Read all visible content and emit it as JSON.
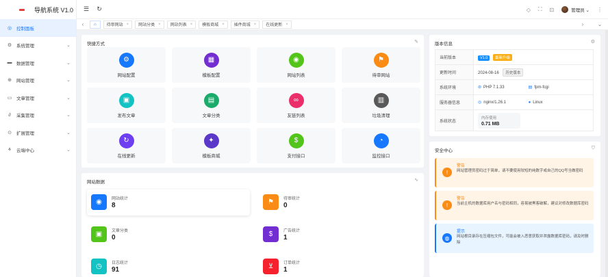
{
  "app": {
    "title": "导航系统 V1.0"
  },
  "sidebar": {
    "items": [
      {
        "label": "控制面板",
        "icon": "dashboard-icon",
        "glyph": "◎",
        "active": true
      },
      {
        "label": "系统管理",
        "icon": "gear-icon",
        "glyph": "⚙"
      },
      {
        "label": "数据管理",
        "icon": "database-icon",
        "glyph": "▬"
      },
      {
        "label": "网站管理",
        "icon": "globe-icon",
        "glyph": "⊕"
      },
      {
        "label": "文章管理",
        "icon": "book-icon",
        "glyph": "▭"
      },
      {
        "label": "采集管理",
        "icon": "link-icon",
        "glyph": "∂"
      },
      {
        "label": "扩展管理",
        "icon": "extension-icon",
        "glyph": "⊙"
      },
      {
        "label": "云端中心",
        "icon": "cloud-icon",
        "glyph": "⚘"
      }
    ]
  },
  "header": {
    "user": "管理员"
  },
  "tabs": [
    {
      "label": "待审网站"
    },
    {
      "label": "网站分类"
    },
    {
      "label": "网站列表"
    },
    {
      "label": "模板商城"
    },
    {
      "label": "插件商城"
    },
    {
      "label": "在线更新"
    }
  ],
  "quick": {
    "title": "快捷方式",
    "items": [
      {
        "label": "网站配置",
        "icon": "settings-icon",
        "glyph": "⚙",
        "color": "#1677ff"
      },
      {
        "label": "模板配置",
        "icon": "template-icon",
        "glyph": "▦",
        "color": "#722ed1"
      },
      {
        "label": "网站列表",
        "icon": "globe-icon",
        "glyph": "◉",
        "color": "#52c41a"
      },
      {
        "label": "待审网站",
        "icon": "flag-icon",
        "glyph": "⚑",
        "color": "#fa8c16"
      },
      {
        "label": "发布文章",
        "icon": "book-icon",
        "glyph": "▣",
        "color": "#13c2c2"
      },
      {
        "label": "文章分类",
        "icon": "document-icon",
        "glyph": "▤",
        "color": "#1aab6a"
      },
      {
        "label": "友链列表",
        "icon": "link-icon",
        "glyph": "∞",
        "color": "#eb2f6b"
      },
      {
        "label": "垃圾清理",
        "icon": "trash-icon",
        "glyph": "▥",
        "color": "#595959"
      },
      {
        "label": "在线更新",
        "icon": "refresh-icon",
        "glyph": "↻",
        "color": "#6e3ff0"
      },
      {
        "label": "模板商城",
        "icon": "shop-icon",
        "glyph": "✦",
        "color": "#5b38c9"
      },
      {
        "label": "支付接口",
        "icon": "payment-icon",
        "glyph": "$",
        "color": "#52c41a"
      },
      {
        "label": "监控接口",
        "icon": "monitor-icon",
        "glyph": "◔",
        "color": "#1677ff"
      }
    ]
  },
  "stats": {
    "title": "网站数据",
    "items": [
      {
        "label": "网站统计",
        "value": "8",
        "icon": "globe-icon",
        "glyph": "◉",
        "color": "#1677ff"
      },
      {
        "label": "待审统计",
        "value": "0",
        "icon": "flag-icon",
        "glyph": "⚑",
        "color": "#fa8c16"
      },
      {
        "label": "文章分类",
        "value": "0",
        "icon": "book-icon",
        "glyph": "▣",
        "color": "#52c41a"
      },
      {
        "label": "广告统计",
        "value": "1",
        "icon": "payment-icon",
        "glyph": "$",
        "color": "#722ed1"
      },
      {
        "label": "日志统计",
        "value": "91",
        "icon": "clock-icon",
        "glyph": "◷",
        "color": "#13c2c2"
      },
      {
        "label": "订单统计",
        "value": "1",
        "icon": "cart-icon",
        "glyph": "⊻",
        "color": "#f5222d"
      }
    ]
  },
  "version": {
    "title": "版本信息",
    "rows": {
      "current": {
        "key": "当前版本",
        "badge1": "V1.0",
        "badge2": "最新升级"
      },
      "update": {
        "key": "更新时间",
        "value": "2024-08-16",
        "badge": "历史版本"
      },
      "env": {
        "key": "系统环境",
        "php": "PHP 7.1.33",
        "fpm": "fpm-fcgi"
      },
      "server": {
        "key": "服务器信息",
        "web": "nginx/1.26.1",
        "os": "Linux"
      },
      "status": {
        "key": "系统状态",
        "mem_label": "内存使用",
        "mem_value": "0.71 MB"
      }
    }
  },
  "security": {
    "title": "安全中心",
    "alerts": [
      {
        "type": "warn",
        "title": "警告",
        "text": "网站管理员密码过于简单，请不要使用较短的纯数字或自己的QQ号当做密码"
      },
      {
        "type": "warn",
        "title": "警告",
        "text": "当前主机的数据库用户名与密码相同，容易被黑客破解，建议对修改数据库密码"
      },
      {
        "type": "info",
        "title": "提示",
        "text": "网站根目录存在压缩包文件，可能会被入恶意获取并泄露数据库密码，请及时删除"
      }
    ]
  }
}
